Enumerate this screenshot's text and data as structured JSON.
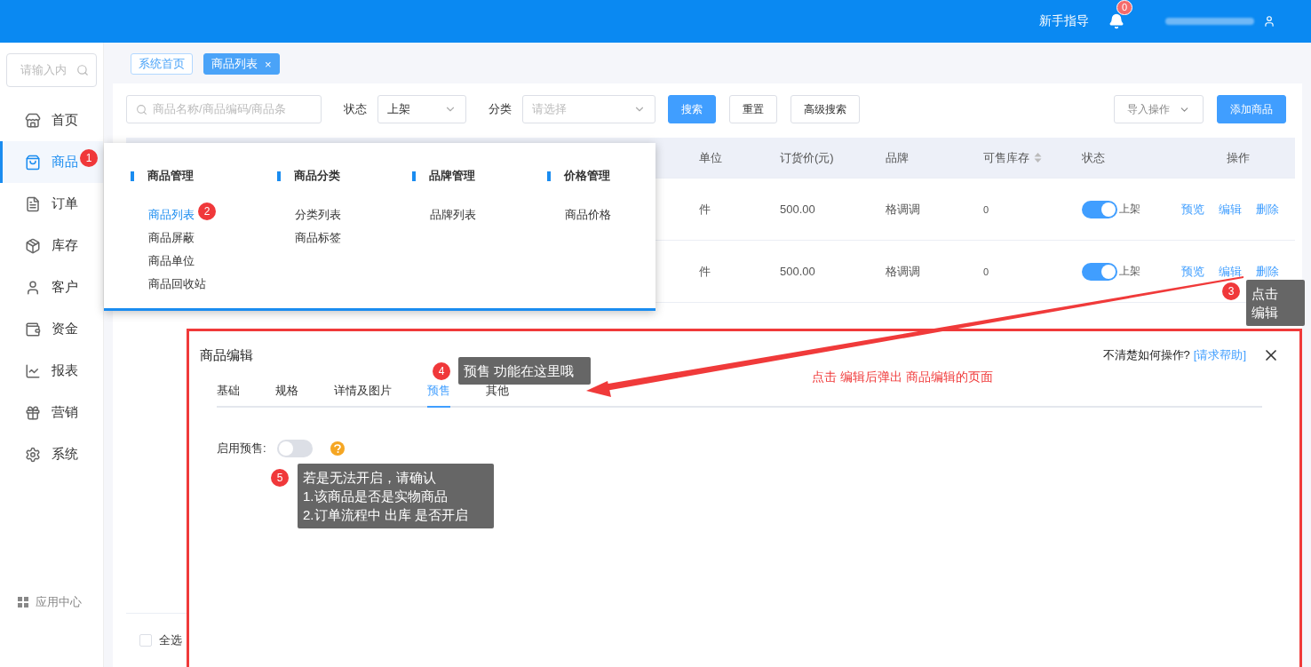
{
  "header": {
    "guide": "新手指导",
    "notification_count": "0"
  },
  "sidebar": {
    "search_placeholder": "请输入内",
    "items": [
      {
        "label": "首页",
        "selected": false
      },
      {
        "label": "商品",
        "selected": true
      },
      {
        "label": "订单",
        "selected": false
      },
      {
        "label": "库存",
        "selected": false
      },
      {
        "label": "客户",
        "selected": false
      },
      {
        "label": "资金",
        "selected": false
      },
      {
        "label": "报表",
        "selected": false
      },
      {
        "label": "营销",
        "selected": false
      },
      {
        "label": "系统",
        "selected": false
      }
    ],
    "footer": "应用中心"
  },
  "page_tabs": [
    {
      "label": "系统首页",
      "selected": false
    },
    {
      "label": "商品列表",
      "selected": true,
      "close": "×"
    }
  ],
  "filters": {
    "search_placeholder": "商品名称/商品编码/商品条",
    "status_label": "状态",
    "status_value": "上架",
    "category_label": "分类",
    "category_placeholder": "请选择",
    "buttons": [
      {
        "label": "搜索",
        "kind": "primary"
      },
      {
        "label": "重置",
        "kind": "default"
      },
      {
        "label": "高级搜索",
        "kind": "default"
      }
    ],
    "import": "导入操作",
    "add": "添加商品"
  },
  "table": {
    "columns": [
      {
        "label": "单位",
        "sortable": false
      },
      {
        "label": "订货价(元)",
        "sortable": false
      },
      {
        "label": "品牌",
        "sortable": false
      },
      {
        "label": "可售库存",
        "sortable": true
      },
      {
        "label": "状态",
        "sortable": false
      },
      {
        "label": "操作",
        "sortable": false
      }
    ],
    "rows": [
      {
        "unit": "件",
        "price": "500.00",
        "brand": "格调调",
        "stock": "0",
        "on": true,
        "status": "上架",
        "actions": [
          "预览",
          "编辑",
          "删除"
        ]
      },
      {
        "unit": "件",
        "price": "500.00",
        "brand": "格调调",
        "stock": "0",
        "on": true,
        "status": "上架",
        "actions": [
          "预览",
          "编辑",
          "删除"
        ]
      }
    ],
    "footer": {
      "select_all": "全选",
      "checked": false
    }
  },
  "mega_menu": {
    "groups": [
      {
        "title": "商品管理",
        "items": [
          {
            "label": "商品列表",
            "selected": true
          },
          {
            "label": "商品屏蔽",
            "selected": false
          },
          {
            "label": "商品单位",
            "selected": false
          },
          {
            "label": "商品回收站",
            "selected": false
          }
        ]
      },
      {
        "title": "商品分类",
        "items": [
          {
            "label": "分类列表",
            "selected": false
          },
          {
            "label": "商品标签",
            "selected": false
          }
        ]
      },
      {
        "title": "品牌管理",
        "items": [
          {
            "label": "品牌列表",
            "selected": false
          }
        ]
      },
      {
        "title": "价格管理",
        "items": [
          {
            "label": "商品价格",
            "selected": false
          }
        ]
      }
    ]
  },
  "dialog": {
    "title": "商品编辑",
    "help_text": "不清楚如何操作?",
    "help_link": "[请求帮助]",
    "tabs": [
      {
        "label": "基础",
        "selected": false
      },
      {
        "label": "规格",
        "selected": false
      },
      {
        "label": "详情及图片",
        "selected": false
      },
      {
        "label": "预售",
        "selected": true
      },
      {
        "label": "其他",
        "selected": false
      }
    ],
    "presale": {
      "label": "启用预售:",
      "on": false
    }
  },
  "annotations": {
    "note": "点击 编辑后弹出 商品编辑的页面",
    "callouts": [
      {
        "number": "1"
      },
      {
        "number": "2"
      },
      {
        "number": "3",
        "text": "点击编辑"
      },
      {
        "number": "4",
        "text": "预售 功能在这里哦"
      },
      {
        "number": "5",
        "text": "若是无法开启，请确认\n1.该商品是否是实物商品\n2.订单流程中 出库  是否开启"
      }
    ]
  }
}
